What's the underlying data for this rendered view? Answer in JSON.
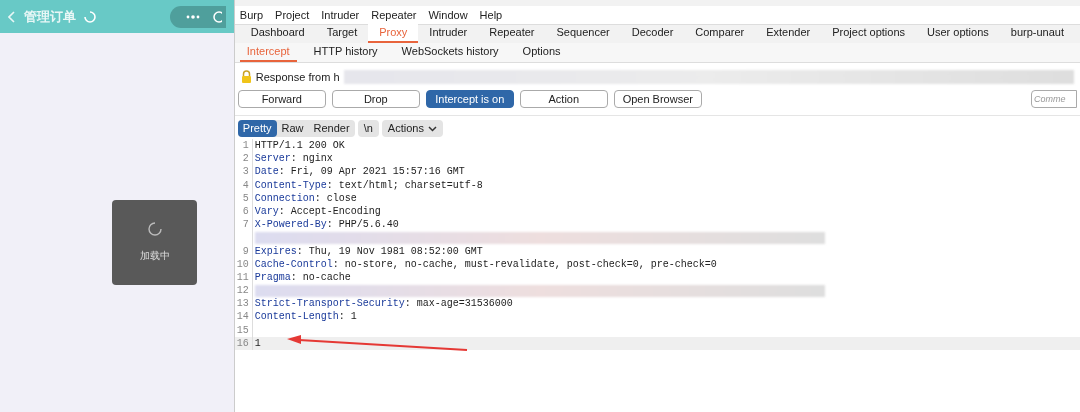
{
  "phone": {
    "title": "管理订单",
    "loading_text": "加载中"
  },
  "burp": {
    "menu": [
      "Burp",
      "Project",
      "Intruder",
      "Repeater",
      "Window",
      "Help"
    ],
    "tabs": [
      {
        "label": "Dashboard",
        "selected": false
      },
      {
        "label": "Target",
        "selected": false
      },
      {
        "label": "Proxy",
        "selected": true
      },
      {
        "label": "Intruder",
        "selected": false
      },
      {
        "label": "Repeater",
        "selected": false
      },
      {
        "label": "Sequencer",
        "selected": false
      },
      {
        "label": "Decoder",
        "selected": false
      },
      {
        "label": "Comparer",
        "selected": false
      },
      {
        "label": "Extender",
        "selected": false
      },
      {
        "label": "Project options",
        "selected": false
      },
      {
        "label": "User options",
        "selected": false
      },
      {
        "label": "burp-unaut",
        "selected": false
      }
    ],
    "subtabs": [
      {
        "label": "Intercept",
        "selected": true
      },
      {
        "label": "HTTP history",
        "selected": false
      },
      {
        "label": "WebSockets history",
        "selected": false
      },
      {
        "label": "Options",
        "selected": false
      }
    ],
    "response_from": "Response from h",
    "buttons": [
      {
        "label": "Forward",
        "on": false
      },
      {
        "label": "Drop",
        "on": false
      },
      {
        "label": "Intercept is on",
        "on": true
      },
      {
        "label": "Action",
        "on": false
      },
      {
        "label": "Open Browser",
        "on": false
      }
    ],
    "comment_placeholder": "Comme",
    "view_tabs": [
      {
        "label": "Pretty",
        "selected": true
      },
      {
        "label": "Raw",
        "selected": false
      },
      {
        "label": "Render",
        "selected": false
      }
    ],
    "newline_button": "\\n",
    "actions_button": "Actions",
    "lines": [
      {
        "kind": "plain",
        "number": "1",
        "text": "HTTP/1.1 200 OK"
      },
      {
        "kind": "header",
        "number": "2",
        "key": "Server",
        "value": ": nginx"
      },
      {
        "kind": "header",
        "number": "3",
        "key": "Date",
        "value": ": Fri, 09 Apr 2021 15:57:16 GMT"
      },
      {
        "kind": "header",
        "number": "4",
        "key": "Content-Type",
        "value": ": text/html; charset=utf-8"
      },
      {
        "kind": "header",
        "number": "5",
        "key": "Connection",
        "value": ": close"
      },
      {
        "kind": "header",
        "number": "6",
        "key": "Vary",
        "value": ": Accept-Encoding"
      },
      {
        "kind": "header",
        "number": "7",
        "key": "X-Powered-By",
        "value": ": PHP/5.6.40"
      },
      {
        "kind": "redacted"
      },
      {
        "kind": "header",
        "number": "9",
        "key": "Expires",
        "value": ": Thu, 19 Nov 1981 08:52:00 GMT"
      },
      {
        "kind": "header",
        "number": "10",
        "key": "Cache-Control",
        "value": ": no-store, no-cache, must-revalidate, post-check=0, pre-check=0"
      },
      {
        "kind": "header",
        "number": "11",
        "key": "Pragma",
        "value": ": no-cache"
      },
      {
        "kind": "redacted",
        "number": "12"
      },
      {
        "kind": "header",
        "number": "13",
        "key": "Strict-Transport-Security",
        "value": ": max-age=31536000"
      },
      {
        "kind": "header",
        "number": "14",
        "key": "Content-Length",
        "value": ": 1"
      },
      {
        "kind": "plain",
        "number": "15"
      },
      {
        "kind": "highlighted",
        "number": "16",
        "text": "1"
      }
    ]
  }
}
